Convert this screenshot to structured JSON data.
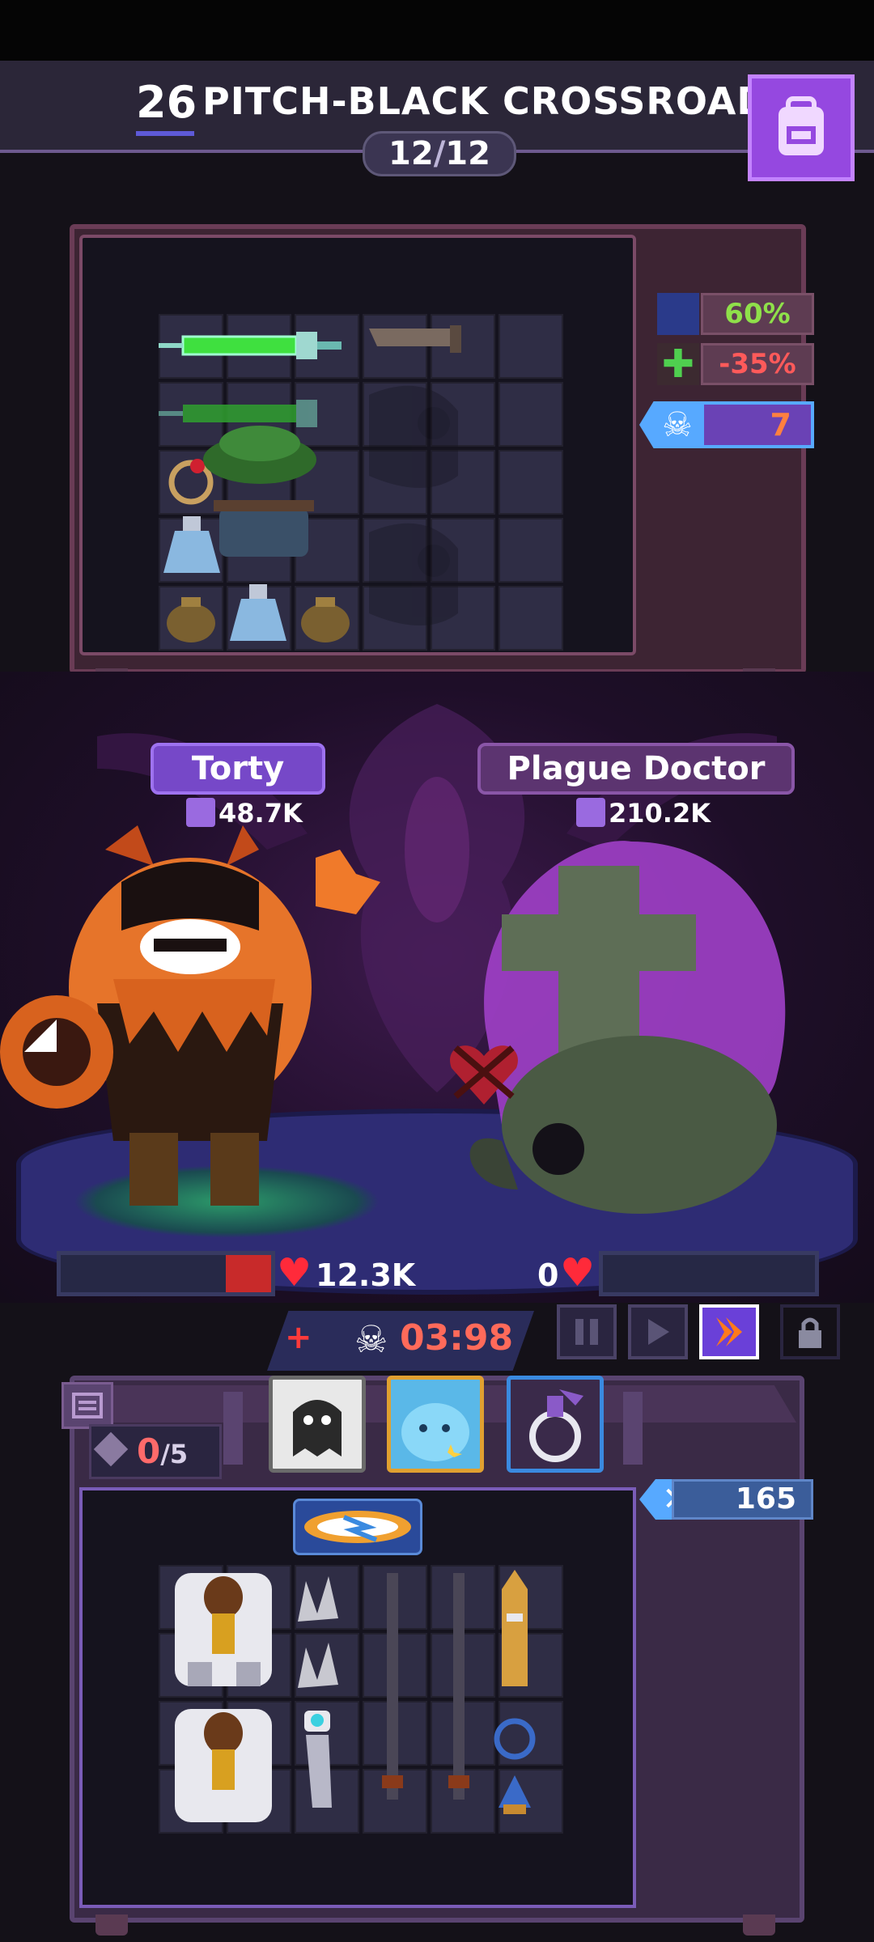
{
  "header": {
    "level": "26",
    "title": "PITCH-BLACK CROSSROADS",
    "progress_current": "12",
    "progress_separator": "/",
    "progress_total": "12"
  },
  "enemy_stats": {
    "stat1": "60%",
    "stat2": "-35%",
    "skull_count": "7"
  },
  "hero": {
    "name": "Torty",
    "power": "48.7K",
    "hp": "12.3K"
  },
  "enemy": {
    "name": "Plague Doctor",
    "power": "210.2K",
    "hp": "0"
  },
  "battle": {
    "timer": "03:98"
  },
  "player_panel": {
    "counter_value": "0",
    "counter_max": "/5",
    "kills": "165"
  },
  "colors": {
    "accent_purple": "#9548e0",
    "hp_red": "#e0232b",
    "timer_red": "#ff6a5a",
    "stat_green": "#8fe04a",
    "stat_red": "#ff5a5a"
  }
}
